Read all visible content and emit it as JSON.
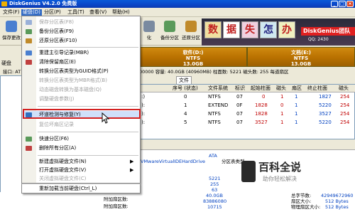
{
  "window": {
    "title": "DiskGenius V4.2.0 免费版"
  },
  "menubar": {
    "items": [
      "文件(F)",
      "硬盘(D)",
      "分区(P)",
      "工具(T)",
      "查看(V)",
      "帮助(H)"
    ],
    "active_index": 1
  },
  "toolbar": {
    "save_label": "保存更改",
    "buttons": [
      "保存更改",
      "化",
      "备份分区",
      "还原分区",
      "快速分区"
    ]
  },
  "banner": {
    "chars": [
      "数",
      "据",
      "失",
      "怎",
      "办"
    ],
    "brand": "DiskGenius团队",
    "qq": "QQ: 2430"
  },
  "disk_label": "硬盘",
  "interface_label": "接口: AT",
  "partitions": [
    {
      "name": "软件(D:)",
      "fs": "NTFS",
      "size": "13.0GB"
    },
    {
      "name": "文档(E:)",
      "fs": "NTFS",
      "size": "13.0GB"
    }
  ],
  "info_line": "00000 容量: 40.0GB (40960MB) 柱面数: 5221 磁头数: 255 每道扇区",
  "tabs": [
    "文件"
  ],
  "table": {
    "headers": [
      "序号 (状态)",
      "文件系统",
      "标识",
      "起始柱面",
      "磁头",
      "扇区",
      "终止柱面",
      "磁头"
    ],
    "rows": [
      [
        "0",
        "NTFS",
        "07",
        "0",
        "1",
        "1",
        "1827",
        "254"
      ],
      [
        "1",
        "EXTEND",
        "0F",
        "1828",
        "0",
        "1",
        "5220",
        "254"
      ],
      [
        "4",
        "NTFS",
        "07",
        "1828",
        "1",
        "1",
        "3527",
        "254"
      ],
      [
        "5",
        "NTFS",
        "07",
        "3527",
        "1",
        "1",
        "5220",
        "254"
      ]
    ]
  },
  "row_prefixes": [
    ":)",
    "):",
    "):",
    "):"
  ],
  "details": {
    "labels": [
      "ATA",
      "VMwareVirtualIDEHardDrive",
      "",
      "5221",
      "255",
      "63",
      "40.0GB",
      "83886080",
      "10715"
    ],
    "right_labels": [
      "分区表类型",
      "",
      "",
      "总字节数:",
      "扇区大小:",
      "物理扇区大小:"
    ],
    "right_values": [
      "",
      "",
      "",
      "42949672960",
      "512 Bytes",
      "512 Bytes"
    ]
  },
  "left_bottom": [
    "附加扇区数:",
    "附加扇区数:"
  ],
  "menu": {
    "items": [
      {
        "label": "保存分区表(F8)",
        "disabled": true,
        "icon": "save-icon"
      },
      {
        "label": "备份分区表(F9)",
        "disabled": false,
        "icon": "backup-icon"
      },
      {
        "label": "还原分区表(F10)",
        "disabled": false,
        "icon": "restore-icon"
      },
      {
        "sep": true
      },
      {
        "label": "重建主引导记录(MBR)",
        "disabled": false,
        "icon": "mbr-icon"
      },
      {
        "label": "清除保留扇区(E)",
        "disabled": false,
        "icon": "clear-icon"
      },
      {
        "label": "转换分区表类型为GUID格式(P)",
        "disabled": false,
        "icon": ""
      },
      {
        "label": "转换分区表类型为MBR格式(B)",
        "disabled": true,
        "icon": ""
      },
      {
        "label": "动态磁盘转换为基本磁盘(Q)",
        "disabled": true,
        "icon": ""
      },
      {
        "label": "调整硬盘参数(J)",
        "disabled": true,
        "icon": ""
      },
      {
        "sep": true
      },
      {
        "label": "坏道检测与修复(Y)",
        "disabled": false,
        "icon": "bad-sector-icon",
        "highlight": true
      },
      {
        "label": "复位坏扇区记录",
        "disabled": true,
        "icon": ""
      },
      {
        "sep": true
      },
      {
        "label": "快速分区(F6)",
        "disabled": false,
        "icon": "quick-partition-icon"
      },
      {
        "label": "删除所有分区(A)",
        "disabled": false,
        "icon": "delete-icon"
      },
      {
        "sep": true
      },
      {
        "label": "新建虚拟硬盘文件(N)",
        "disabled": false,
        "icon": "",
        "submenu": true
      },
      {
        "label": "打开虚拟硬盘文件(V)",
        "disabled": false,
        "icon": "",
        "submenu": true
      },
      {
        "label": "关闭虚拟硬盘文件(C)",
        "disabled": true,
        "icon": ""
      },
      {
        "sep": true
      },
      {
        "label": "重新加载当前硬盘(Ctrl_L)",
        "disabled": false,
        "icon": ""
      }
    ]
  },
  "watermark": {
    "title": "百科全说",
    "subtitle": "助你轻松解决"
  },
  "colors": {
    "accent": "#316ac5",
    "highlight_border": "#d42020",
    "partition_bar": "#c07a08"
  }
}
